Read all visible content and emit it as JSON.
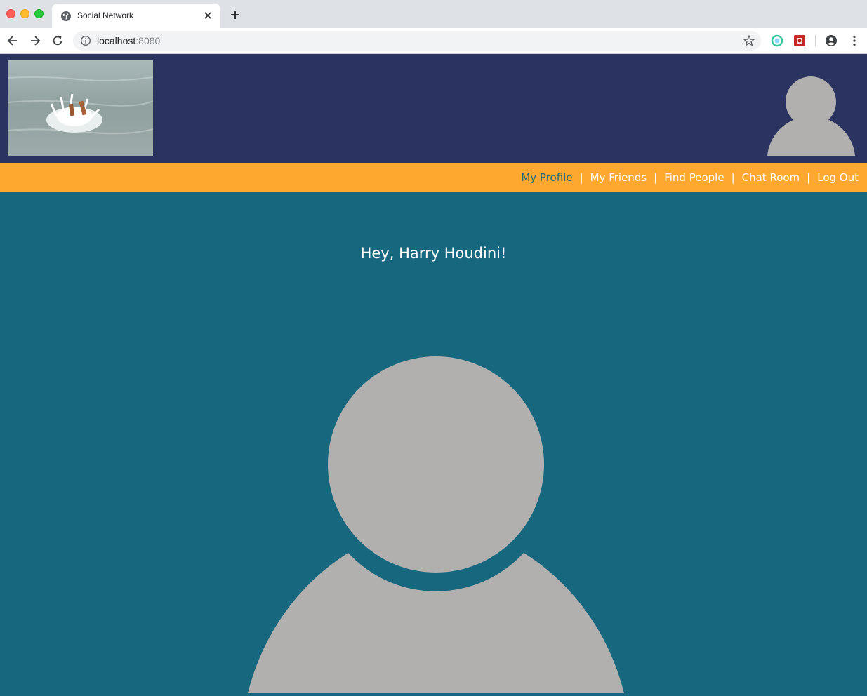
{
  "browser": {
    "tab_title": "Social Network",
    "url_host": "localhost",
    "url_port": ":8080"
  },
  "nav": {
    "links": [
      "My Profile",
      "My Friends",
      "Find People",
      "Chat Room",
      "Log Out"
    ],
    "separator": "|",
    "active_index": 0
  },
  "main": {
    "greeting": "Hey, Harry Houdini!"
  },
  "colors": {
    "header_bg": "#2b3361",
    "nav_bg": "#fea82f",
    "main_bg": "#17677f",
    "avatar_fill": "#b1b0af",
    "active_link": "#17677f"
  }
}
